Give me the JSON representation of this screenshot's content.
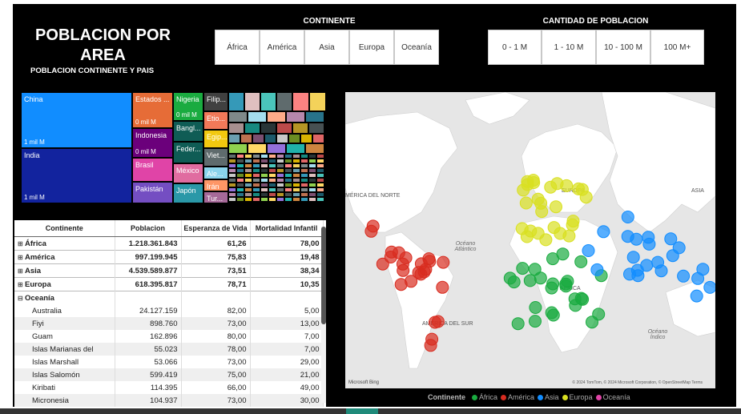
{
  "header": {
    "title": "POBLACION POR AREA",
    "subtitle": "POBLACION CONTINENTE Y PAIS"
  },
  "slicer_continente": {
    "title": "CONTINENTE",
    "options": [
      "África",
      "América",
      "Asia",
      "Europa",
      "Oceanía"
    ]
  },
  "slicer_poblacion": {
    "title": "CANTIDAD DE POBLACION",
    "options": [
      "0 - 1 M",
      "1 - 10 M",
      "10 - 100 M",
      "100 M+"
    ]
  },
  "treemap": {
    "labeled": [
      {
        "label": "China",
        "value": "1 mil M",
        "color": "#118DFF"
      },
      {
        "label": "India",
        "value": "1 mil M",
        "color": "#12239E"
      },
      {
        "label": "Estados ...",
        "value": "0 mil M",
        "color": "#E66C37"
      },
      {
        "label": "Indonesia",
        "value": "0 mil M",
        "color": "#6B007B"
      },
      {
        "label": "Brasil",
        "value": "",
        "color": "#E044A7"
      },
      {
        "label": "Pakistán",
        "value": "",
        "color": "#744EC2"
      },
      {
        "label": "Nigeria",
        "value": "0 mil M",
        "color": "#1AAB40"
      },
      {
        "label": "Bangl...",
        "value": "",
        "color": "#15C6F4"
      },
      {
        "label": "Feder...",
        "value": "",
        "color": "#0F5C55"
      },
      {
        "label": "México",
        "value": "",
        "color": "#E06CA0"
      },
      {
        "label": "Japón",
        "value": "",
        "color": "#2A98A8"
      },
      {
        "label": "Filip...",
        "value": "",
        "color": "#404040"
      },
      {
        "label": "Etio...",
        "value": "",
        "color": "#F27959"
      },
      {
        "label": "Egip...",
        "value": "",
        "color": "#F2C80F"
      },
      {
        "label": "Viet...",
        "value": "",
        "color": "#5F6B6D"
      },
      {
        "label": "Ale...",
        "value": "",
        "color": "#8AD4EB"
      },
      {
        "label": "Irán",
        "value": "",
        "color": "#FE9666"
      },
      {
        "label": "Tur...",
        "value": "",
        "color": "#A66999"
      }
    ],
    "small_colors": [
      "#3599B8",
      "#DFBFBF",
      "#4AC5BB",
      "#5F6B6D",
      "#FB8281",
      "#F4D25A",
      "#7F898A",
      "#A4DDEE",
      "#FDAB89",
      "#B687AC",
      "#28738A",
      "#A78F8F",
      "#168980",
      "#293537",
      "#BB4A4A",
      "#B59525",
      "#475052",
      "#6A9FB0",
      "#BD7150",
      "#7B4F71",
      "#1C5A6B",
      "#C8C8C8",
      "#6B8E23",
      "#D9B300",
      "#E06666",
      "#8FD14F",
      "#FFD966",
      "#9370DB",
      "#20B2AA",
      "#CD853F"
    ]
  },
  "table": {
    "headers": [
      "Continente",
      "Poblacion",
      "Esperanza de Vida",
      "Mortalidad Infantil"
    ],
    "rows": [
      {
        "type": "group",
        "exp": "⊞",
        "name": "África",
        "pob": "1.218.361.843",
        "esp": "61,26",
        "mort": "78,00"
      },
      {
        "type": "group",
        "exp": "⊞",
        "name": "América",
        "pob": "997.199.945",
        "esp": "75,83",
        "mort": "19,48"
      },
      {
        "type": "group",
        "exp": "⊞",
        "name": "Asia",
        "pob": "4.539.589.877",
        "esp": "73,51",
        "mort": "38,34"
      },
      {
        "type": "group",
        "exp": "⊞",
        "name": "Europa",
        "pob": "618.395.817",
        "esp": "78,71",
        "mort": "10,35"
      },
      {
        "type": "group",
        "exp": "⊟",
        "name": "Oceanía",
        "pob": "",
        "esp": "",
        "mort": ""
      },
      {
        "type": "sub",
        "exp": "",
        "name": "Australia",
        "pob": "24.127.159",
        "esp": "82,00",
        "mort": "5,00"
      },
      {
        "type": "sub",
        "exp": "",
        "name": "Fiyi",
        "pob": "898.760",
        "esp": "73,00",
        "mort": "13,00"
      },
      {
        "type": "sub",
        "exp": "",
        "name": "Guam",
        "pob": "162.896",
        "esp": "80,00",
        "mort": "7,00"
      },
      {
        "type": "sub",
        "exp": "",
        "name": "Islas Marianas del",
        "pob": "55.023",
        "esp": "78,00",
        "mort": "7,00"
      },
      {
        "type": "sub",
        "exp": "",
        "name": "Islas Marshall",
        "pob": "53.066",
        "esp": "73,00",
        "mort": "29,00"
      },
      {
        "type": "sub",
        "exp": "",
        "name": "Islas Salomón",
        "pob": "599.419",
        "esp": "75,00",
        "mort": "21,00"
      },
      {
        "type": "sub",
        "exp": "",
        "name": "Kiribati",
        "pob": "114.395",
        "esp": "66,00",
        "mort": "49,00"
      },
      {
        "type": "sub",
        "exp": "",
        "name": "Micronesia",
        "pob": "104.937",
        "esp": "73,00",
        "mort": "30,00"
      }
    ]
  },
  "map": {
    "labels": {
      "north_america": "MÉRICA DEL NORTE",
      "south_america": "AMÉRICA DEL SUR",
      "africa": "ÁFRICA",
      "asia": "ASIA",
      "europe": "EUROPA",
      "atlantic": "Océano Atlántico",
      "indian": "Océano Índico"
    },
    "attribution": "© 2024 TomTom, © 2024 Microsoft Corporation, © OpenStreetMap  Terms",
    "bing": "Microsoft Bing"
  },
  "legend": {
    "title": "Continente",
    "items": [
      {
        "label": "África",
        "color": "#1AAB40"
      },
      {
        "label": "América",
        "color": "#D82C20"
      },
      {
        "label": "Asia",
        "color": "#118DFF"
      },
      {
        "label": "Europa",
        "color": "#D9E021"
      },
      {
        "label": "Oceanía",
        "color": "#E044A7"
      }
    ]
  }
}
